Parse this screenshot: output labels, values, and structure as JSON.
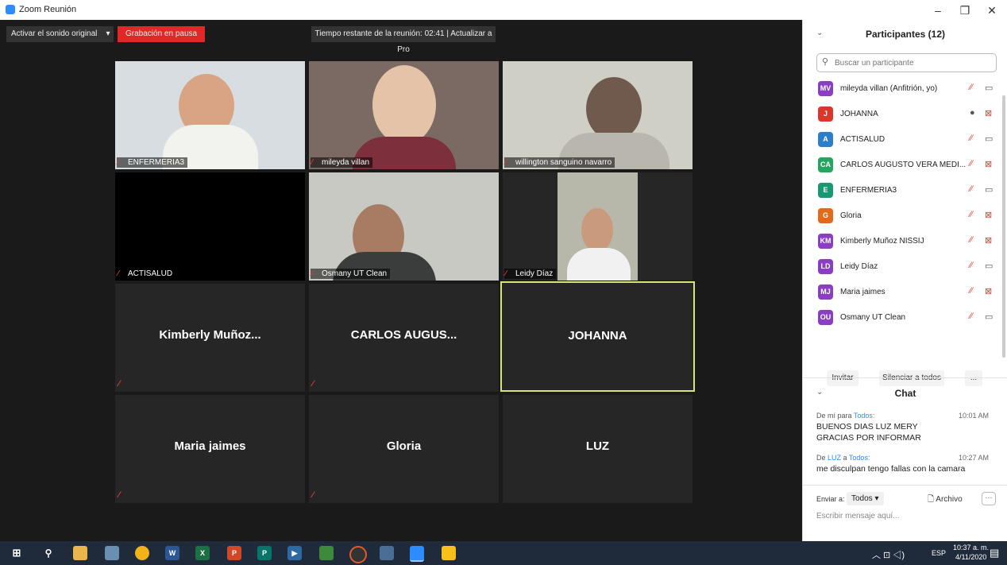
{
  "window": {
    "title": "Zoom Reunión",
    "minimize_icon": "minimize-icon",
    "maximize_icon": "restore-icon",
    "close_icon": "close-icon"
  },
  "topbar": {
    "audio_label": "Activar el sonido original",
    "recording_label": "Grabación en pausa",
    "recording_color": "#e02828",
    "time_remaining": "Tiempo restante de la reunión: 02:41 | Actualizar a Pro"
  },
  "video_tiles": [
    {
      "name": "ENFERMERIA3"
    },
    {
      "name": "mileyda villan"
    },
    {
      "name": "willington sanguino navarro"
    },
    {
      "name": "ACTISALUD"
    },
    {
      "name": "Osmany UT Clean"
    },
    {
      "name": "Leidy Díaz"
    }
  ],
  "name_tiles": [
    {
      "name": "Kimberly  Muñoz..."
    },
    {
      "name": "CARLOS  AUGUS..."
    },
    {
      "name": "JOHANNA",
      "active_speaker": true,
      "highlight_color": "#d8e37a"
    },
    {
      "name": "Maria jaimes"
    },
    {
      "name": "Gloria"
    },
    {
      "name": "LUZ"
    }
  ],
  "participants": {
    "title": "Participantes (12)",
    "search_placeholder": "Buscar un participante",
    "items": [
      {
        "initials": "MV",
        "name": "mileyda villan (Anfitrión, yo)",
        "color": "#8a3fc2",
        "video": "on"
      },
      {
        "initials": "J",
        "name": "JOHANNA",
        "color": "#d9372c",
        "video": "off"
      },
      {
        "initials": "A",
        "name": "ACTISALUD",
        "color": "#2d7ec9",
        "video": "on"
      },
      {
        "initials": "CA",
        "name": "CARLOS AUGUSTO VERA MEDI...",
        "color": "#25a55f",
        "video": "off"
      },
      {
        "initials": "E",
        "name": "ENFERMERIA3",
        "color": "#199873",
        "video": "on"
      },
      {
        "initials": "G",
        "name": "Gloria",
        "color": "#e06b1d",
        "video": "off"
      },
      {
        "initials": "KM",
        "name": "Kimberly Muñoz NISSIJ",
        "color": "#8a3fc2",
        "video": "off"
      },
      {
        "initials": "LD",
        "name": "Leidy Díaz",
        "color": "#8a3fc2",
        "video": "on"
      },
      {
        "initials": "MJ",
        "name": "Maria jaimes",
        "color": "#8a3fc2",
        "video": "off"
      },
      {
        "initials": "OU",
        "name": "Osmany UT Clean",
        "color": "#8a3fc2",
        "video": "on"
      }
    ],
    "invite_label": "Invitar",
    "mute_all_label": "Silenciar a todos",
    "more_label": "..."
  },
  "chat": {
    "title": "Chat",
    "messages": [
      {
        "from": "De mí para",
        "to": "Todos:",
        "time": "10:01 AM",
        "lines": [
          "BUENOS DIAS LUZ MERY",
          "GRACIAS POR INFORMAR"
        ]
      },
      {
        "from": "De",
        "sender": "LUZ",
        "mid": "a",
        "to": "Todos:",
        "time": "10:27 AM",
        "lines": [
          "me disculpan tengo fallas con la camara"
        ]
      }
    ],
    "send_to_label": "Enviar a:",
    "send_to_value": "Todos",
    "file_label": "Archivo",
    "more_label": "···",
    "input_placeholder": "Escribir mensaje aquí..."
  },
  "taskbar": {
    "time": "10:37 a. m.",
    "date": "4/11/2020",
    "lang": "ESP"
  }
}
